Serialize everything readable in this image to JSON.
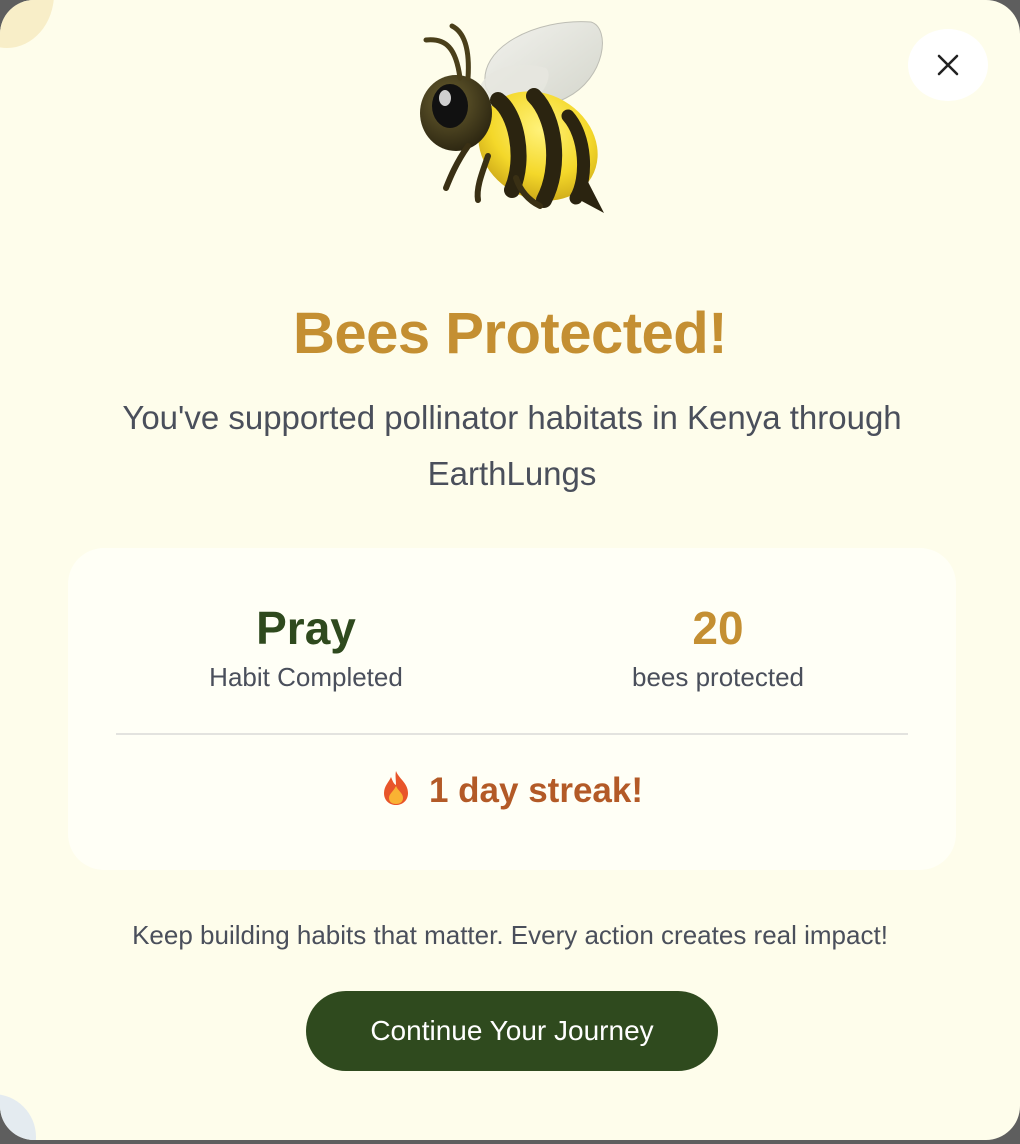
{
  "modal": {
    "title": "Bees Protected!",
    "subtitle": "You've supported pollinator habitats in Kenya through EarthLungs",
    "close_icon": "close-icon",
    "hero_icon": "bee-icon"
  },
  "stats": {
    "habit": {
      "value": "Pray",
      "label": "Habit Completed"
    },
    "impact": {
      "value": "20",
      "label": "bees protected"
    },
    "streak": {
      "icon": "fire-icon",
      "text": "1 day streak!"
    }
  },
  "footer": {
    "message": "Keep building habits that matter. Every action creates real impact!",
    "cta_label": "Continue Your Journey"
  },
  "colors": {
    "background": "#fefdeb",
    "title_gold": "#c48f32",
    "forest_green": "#2f4a1e",
    "streak_orange": "#b35a27"
  }
}
